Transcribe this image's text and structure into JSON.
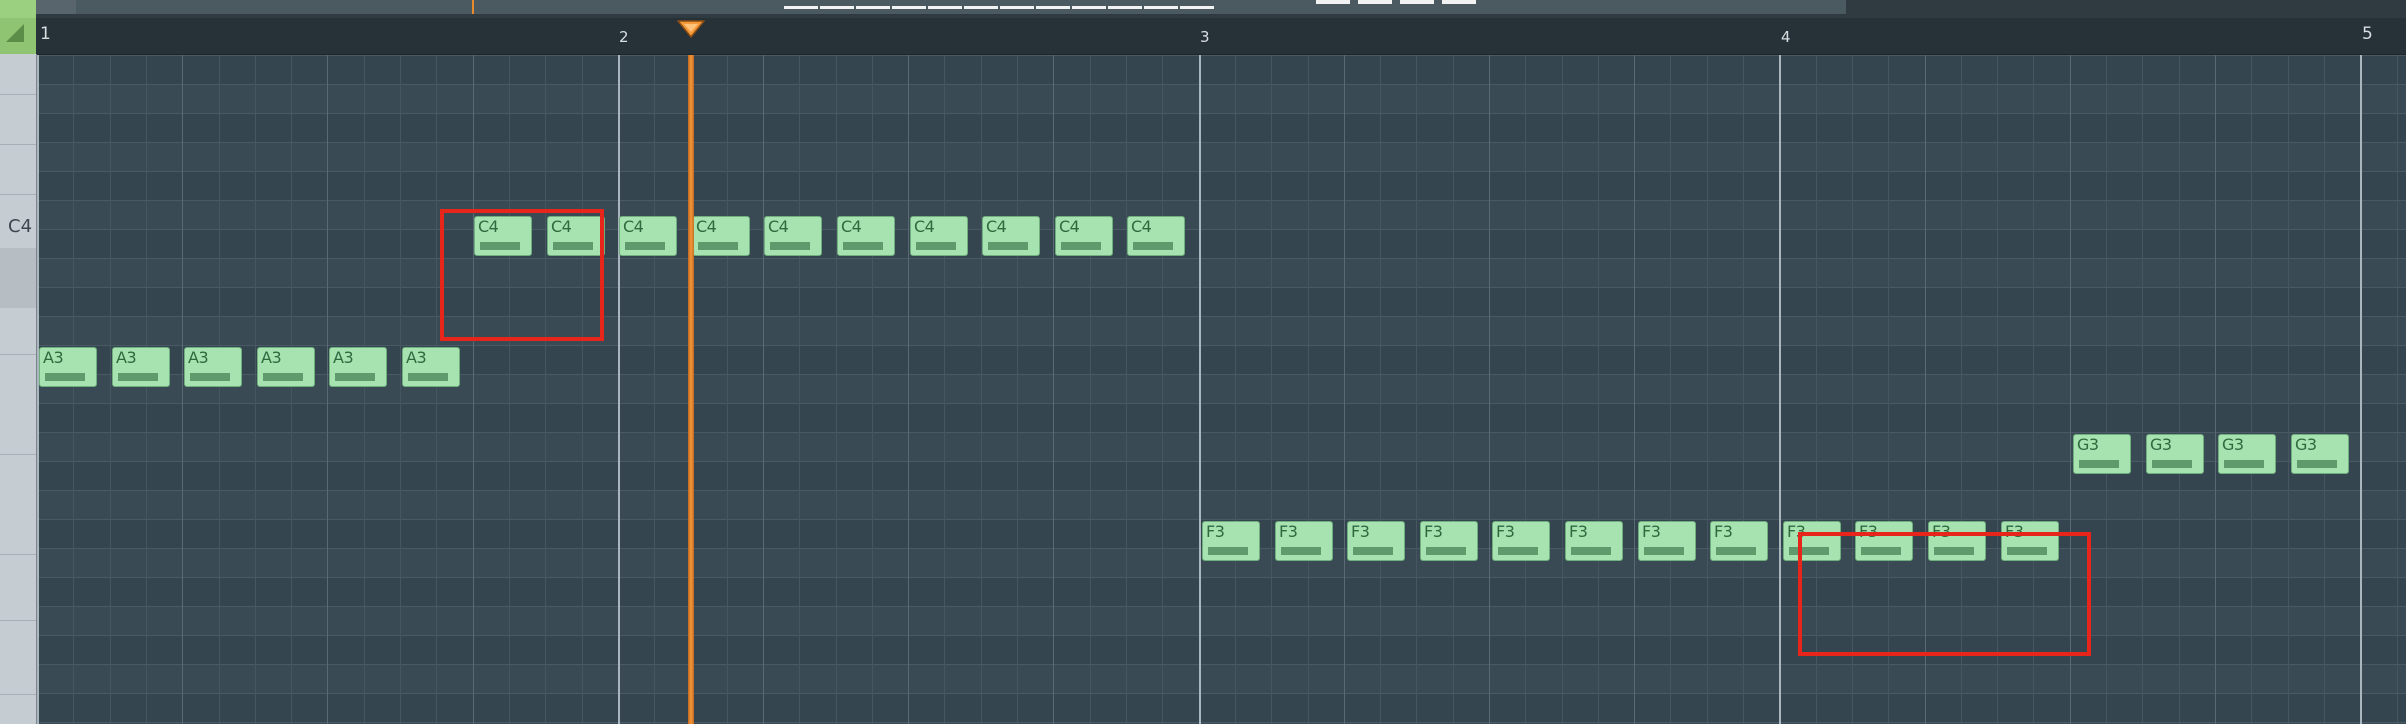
{
  "ruler": {
    "bars": [
      "1",
      "2",
      "3",
      "4",
      "5"
    ]
  },
  "keyboard": {
    "highlight_key": "C4"
  },
  "notes": {
    "a3": [
      "A3",
      "A3",
      "A3",
      "A3",
      "A3",
      "A3"
    ],
    "c4": [
      "C4",
      "C4",
      "C4",
      "C4",
      "C4",
      "C4",
      "C4",
      "C4",
      "C4",
      "C4"
    ],
    "f3": [
      "F3",
      "F3",
      "F3",
      "F3",
      "F3",
      "F3",
      "F3",
      "F3",
      "F3",
      "F3",
      "F3",
      "F3"
    ],
    "g3": [
      "G3",
      "G3",
      "G3",
      "G3"
    ]
  },
  "colors": {
    "note_fill": "#a6e3b0",
    "playhead": "#ff9a38",
    "highlight": "#e8251b",
    "grid_bg": "#35454f"
  }
}
